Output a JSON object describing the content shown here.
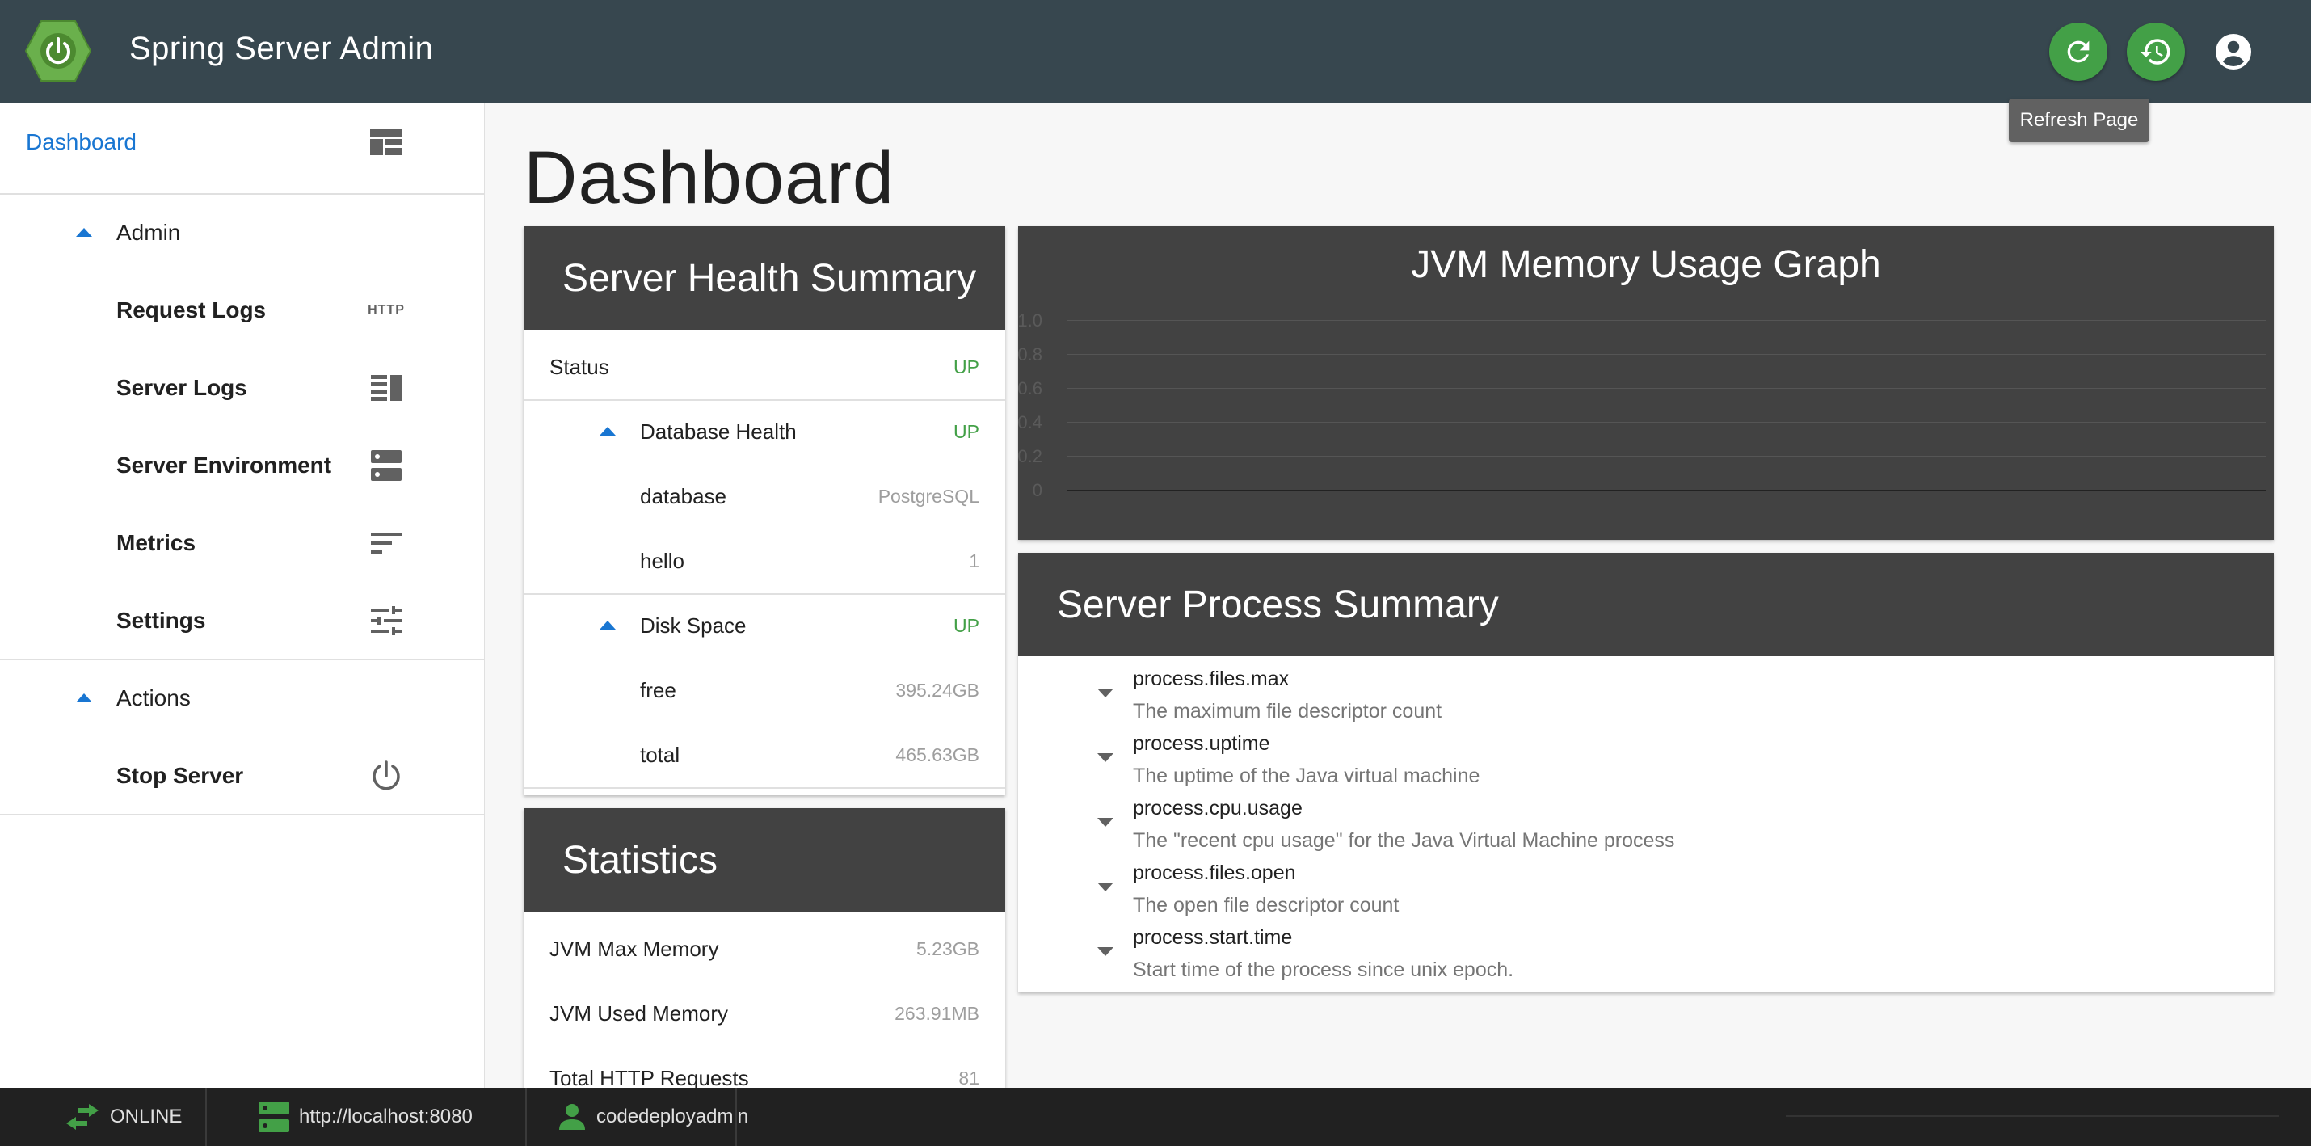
{
  "app": {
    "title": "Spring Server Admin"
  },
  "header": {
    "tooltip": "Refresh Page",
    "icons": [
      "refresh-icon",
      "history-icon",
      "account-circle-icon"
    ]
  },
  "sidebar": {
    "dashboard_label": "Dashboard",
    "admin_label": "Admin",
    "items": [
      {
        "label": "Request Logs",
        "icon": "http-icon",
        "icon_text": "HTTP"
      },
      {
        "label": "Server Logs",
        "icon": "logs-icon"
      },
      {
        "label": "Server Environment",
        "icon": "dns-icon"
      },
      {
        "label": "Metrics",
        "icon": "sort-icon"
      },
      {
        "label": "Settings",
        "icon": "tune-icon"
      }
    ],
    "actions_label": "Actions",
    "action_items": [
      {
        "label": "Stop Server",
        "icon": "power-icon"
      }
    ]
  },
  "page": {
    "title": "Dashboard"
  },
  "health": {
    "title": "Server Health Summary",
    "rows": [
      {
        "label": "Status",
        "value": "UP"
      },
      {
        "label": "Database Health",
        "value": "UP"
      },
      {
        "label": "database",
        "value": "PostgreSQL"
      },
      {
        "label": "hello",
        "value": "1"
      },
      {
        "label": "Disk Space",
        "value": "UP"
      },
      {
        "label": "free",
        "value": "395.24GB"
      },
      {
        "label": "total",
        "value": "465.63GB"
      }
    ]
  },
  "statistics": {
    "title": "Statistics",
    "rows": [
      {
        "label": "JVM Max Memory",
        "value": "5.23GB"
      },
      {
        "label": "JVM Used Memory",
        "value": "263.91MB"
      },
      {
        "label": "Total HTTP Requests",
        "value": "81"
      }
    ]
  },
  "memory_graph": {
    "title": "JVM Memory Usage Graph"
  },
  "chart_data": {
    "type": "line",
    "title": "JVM Memory Usage Graph",
    "series": [],
    "yticks": [
      "1.0",
      "0.8",
      "0.6",
      "0.4",
      "0.2",
      "0"
    ],
    "ylim": [
      0,
      1.0
    ],
    "grid": true
  },
  "process": {
    "title": "Server Process Summary",
    "items": [
      {
        "name": "process.files.max",
        "desc": "The maximum file descriptor count"
      },
      {
        "name": "process.uptime",
        "desc": "The uptime of the Java virtual machine"
      },
      {
        "name": "process.cpu.usage",
        "desc": "The \"recent cpu usage\" for the Java Virtual Machine process"
      },
      {
        "name": "process.files.open",
        "desc": "The open file descriptor count"
      },
      {
        "name": "process.start.time",
        "desc": "Start time of the process since unix epoch."
      }
    ]
  },
  "footer": {
    "status": "ONLINE",
    "url": "http://localhost:8080",
    "user": "codedeployadmin"
  },
  "colors": {
    "header": "#37474f",
    "accent": "#43a047",
    "link": "#1976d2",
    "card_head": "#424242",
    "footer": "#212121"
  }
}
